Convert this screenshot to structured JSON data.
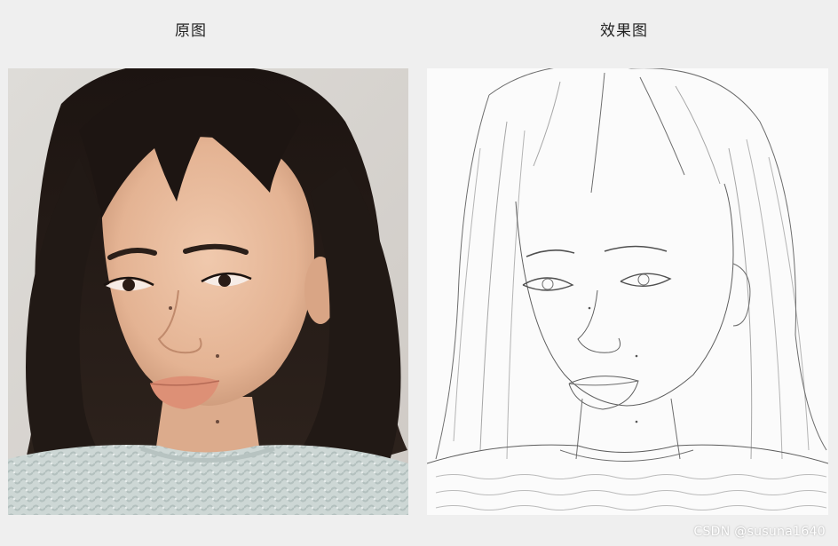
{
  "titles": {
    "original": "原图",
    "effect": "效果图"
  },
  "watermark": "CSDN @susuna1640",
  "colors": {
    "background": "#efefef",
    "hair": "#241a16",
    "skin": "#e8bca0",
    "sweater": "#cfd8d6",
    "sketch_paper": "#fbfbfb",
    "sketch_line": "#3a3a3a"
  }
}
